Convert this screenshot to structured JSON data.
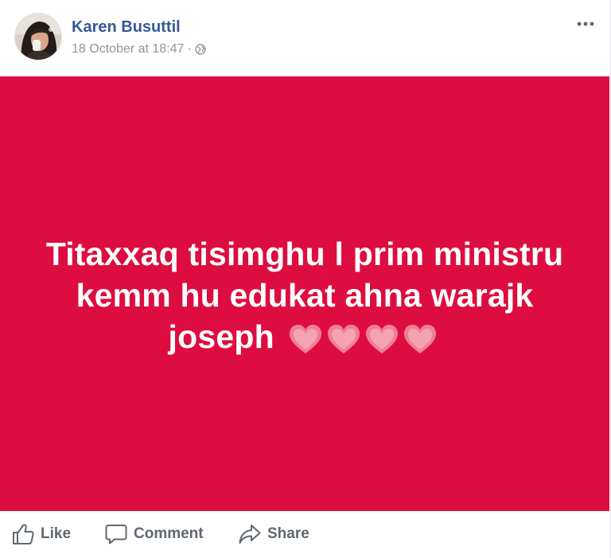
{
  "post": {
    "author": "Karen Busuttil",
    "timestamp": "18 October at 18:47",
    "separator": "·",
    "privacy_icon": "globe-icon",
    "menu_icon": "more-options-icon",
    "text": "Titaxxaq tisimghu l prim ministru kemm hu edukat ahna warajk joseph",
    "emoji": [
      "heart",
      "heart",
      "heart",
      "heart"
    ],
    "background_color": "#de0d40"
  },
  "actions": {
    "like_label": "Like",
    "comment_label": "Comment",
    "share_label": "Share"
  },
  "colors": {
    "author_link": "#365899",
    "meta_text": "#90949c",
    "action_text": "#606770"
  }
}
